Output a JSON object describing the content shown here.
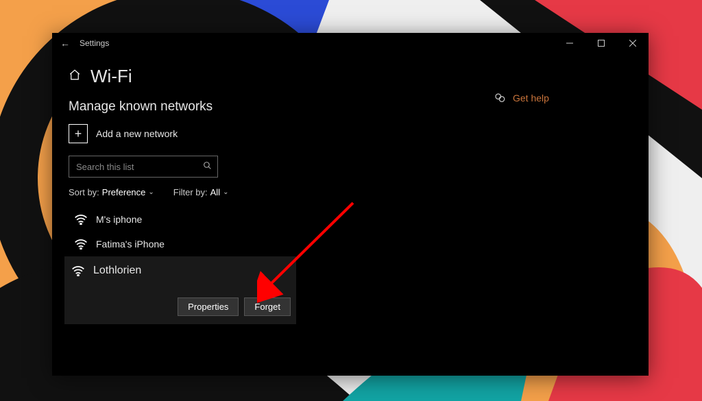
{
  "titlebar": {
    "app": "Settings"
  },
  "header": {
    "title": "Wi-Fi"
  },
  "section": {
    "title": "Manage known networks",
    "add_label": "Add a new network",
    "search_placeholder": "Search this list",
    "sort_label": "Sort by:",
    "sort_value": "Preference",
    "filter_label": "Filter by:",
    "filter_value": "All"
  },
  "networks": [
    {
      "name": "M's iphone"
    },
    {
      "name": "Fatima's iPhone"
    },
    {
      "name": "Lothlorien",
      "selected": true
    }
  ],
  "actions": {
    "properties": "Properties",
    "forget": "Forget"
  },
  "sidebar": {
    "help": "Get help"
  }
}
